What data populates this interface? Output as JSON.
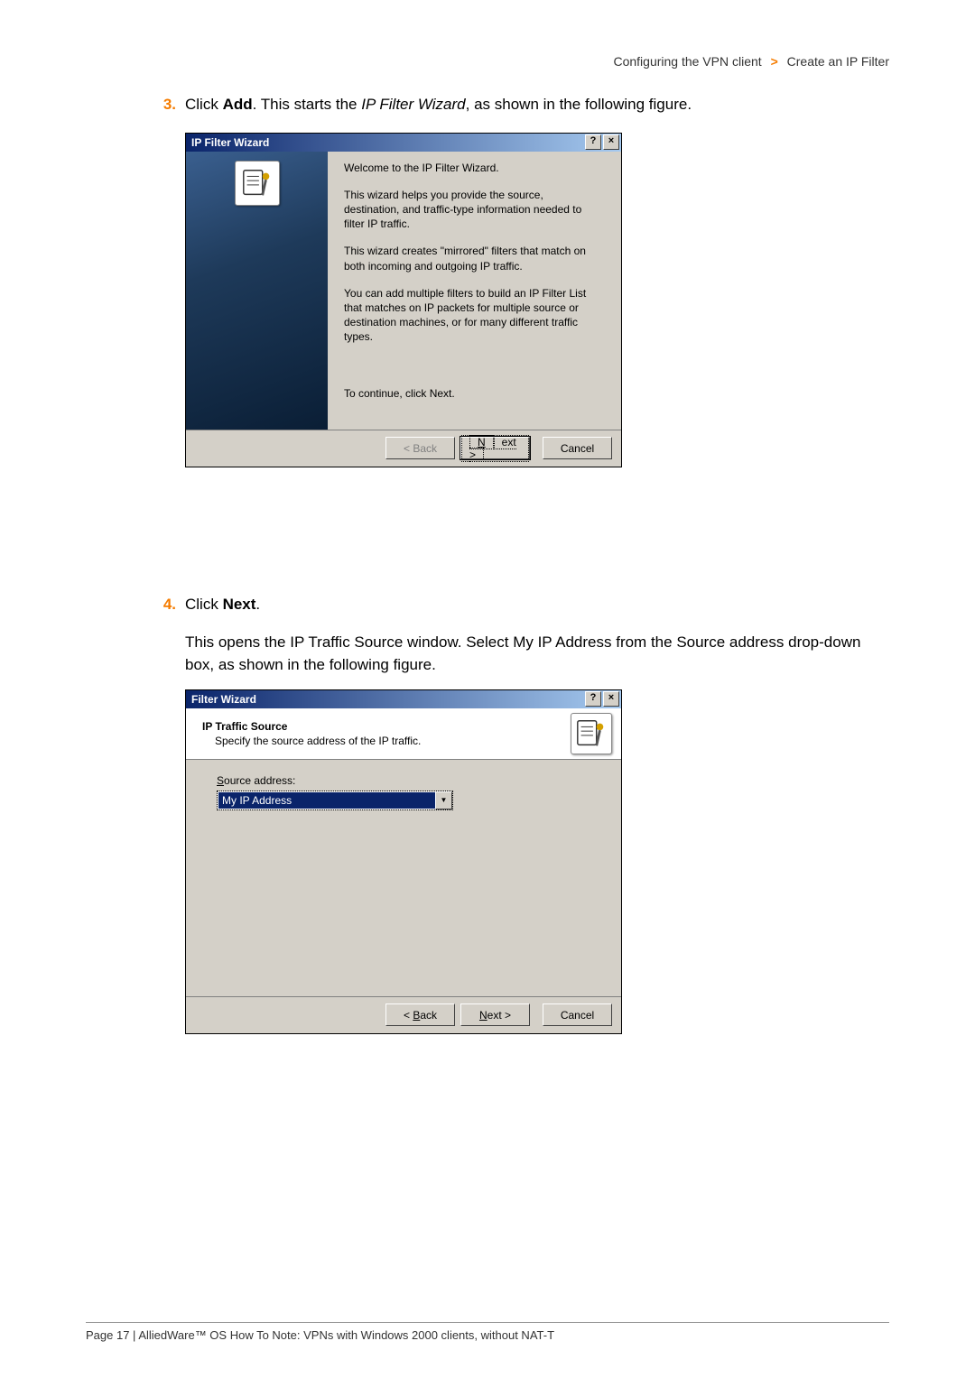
{
  "breadcrumb": {
    "section": "Configuring the VPN client",
    "arrow": ">",
    "page": "Create an IP Filter"
  },
  "step3": {
    "num": "3.",
    "pre": "Click ",
    "bold": "Add",
    "post1": ". This starts the ",
    "italic": "IP Filter Wizard",
    "post2": ", as shown in the following figure."
  },
  "dlg1": {
    "title": "IP Filter Wizard",
    "p1": "Welcome to the IP Filter Wizard.",
    "p2": "This wizard helps you provide the source, destination, and traffic-type information needed to filter IP traffic.",
    "p3": "This wizard creates \"mirrored\" filters that match on both incoming and outgoing IP traffic.",
    "p4": "You can add multiple filters to build an IP Filter List that matches on IP packets for multiple source or destination machines, or for many different traffic types.",
    "p5": "To continue, click Next.",
    "back": "< Back",
    "next_u": "N",
    "next_rest": "ext >",
    "cancel": "Cancel"
  },
  "step4": {
    "num": "4.",
    "pre": "Click ",
    "bold": "Next",
    "post": ".",
    "desc_pre": "This opens the ",
    "desc_i1": "IP Traffic Source",
    "desc_mid": " window. Select ",
    "desc_i2": "My IP Address",
    "desc_mid2": " from the ",
    "desc_i3": "Source address",
    "desc_post": " drop-down box, as shown in the following figure."
  },
  "dlg2": {
    "title": "Filter Wizard",
    "head1": "IP Traffic Source",
    "head2": "Specify the source address of the IP traffic.",
    "label_u": "S",
    "label_rest": "ource address:",
    "combo_value": "My IP Address",
    "back_u": "B",
    "back_pre": "< ",
    "back_rest": "ack",
    "next_u": "N",
    "next_rest": "ext >",
    "cancel": "Cancel"
  },
  "footer": "Page 17 | AlliedWare™ OS How To Note: VPNs with Windows 2000 clients, without NAT-T"
}
